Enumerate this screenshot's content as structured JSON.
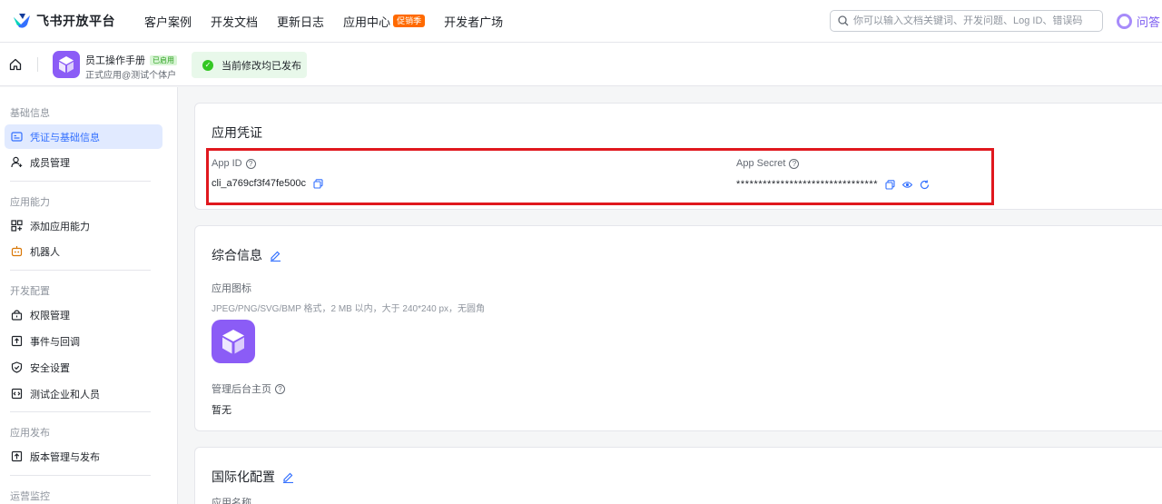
{
  "topnav": {
    "logo_text": "飞书开放平台",
    "items": [
      {
        "label": "客户案例"
      },
      {
        "label": "开发文档"
      },
      {
        "label": "更新日志"
      },
      {
        "label": "应用中心",
        "badge": "促销季"
      },
      {
        "label": "开发者广场"
      }
    ],
    "search_placeholder": "你可以输入文档关键词、开发问题、Log ID、错误码",
    "ask_label": "问答"
  },
  "app": {
    "name": "员工操作手册",
    "status_badge": "已启用",
    "subtitle": "正式应用@测试个体户",
    "publish_status": "当前修改均已发布"
  },
  "sidebar": {
    "groups": [
      {
        "title": "基础信息",
        "items": [
          {
            "label": "凭证与基础信息",
            "icon": "credential-icon",
            "active": true
          },
          {
            "label": "成员管理",
            "icon": "member-icon"
          }
        ]
      },
      {
        "title": "应用能力",
        "items": [
          {
            "label": "添加应用能力",
            "icon": "apps-icon"
          },
          {
            "label": "机器人",
            "icon": "robot-icon"
          }
        ]
      },
      {
        "title": "开发配置",
        "items": [
          {
            "label": "权限管理",
            "icon": "lock-icon"
          },
          {
            "label": "事件与回调",
            "icon": "event-icon"
          },
          {
            "label": "安全设置",
            "icon": "shield-icon"
          },
          {
            "label": "测试企业和人员",
            "icon": "code-icon"
          }
        ]
      },
      {
        "title": "应用发布",
        "items": [
          {
            "label": "版本管理与发布",
            "icon": "upload-icon"
          }
        ]
      },
      {
        "title": "运营监控",
        "items": []
      }
    ]
  },
  "credentials": {
    "title": "应用凭证",
    "app_id_label": "App ID",
    "app_id_value": "cli_a769cf3f47fe500c",
    "app_secret_label": "App Secret",
    "app_secret_value": "********************************"
  },
  "general": {
    "title": "综合信息",
    "icon_label": "应用图标",
    "icon_hint": "JPEG/PNG/SVG/BMP 格式，2 MB 以内，大于 240*240 px，无圆角",
    "homepage_label": "管理后台主页",
    "homepage_value": "暂无"
  },
  "i18n": {
    "title": "国际化配置",
    "name_label": "应用名称"
  },
  "colors": {
    "accent": "#3370ff",
    "highlight_border": "#e0181e",
    "app_icon": "#8b5cf6"
  }
}
